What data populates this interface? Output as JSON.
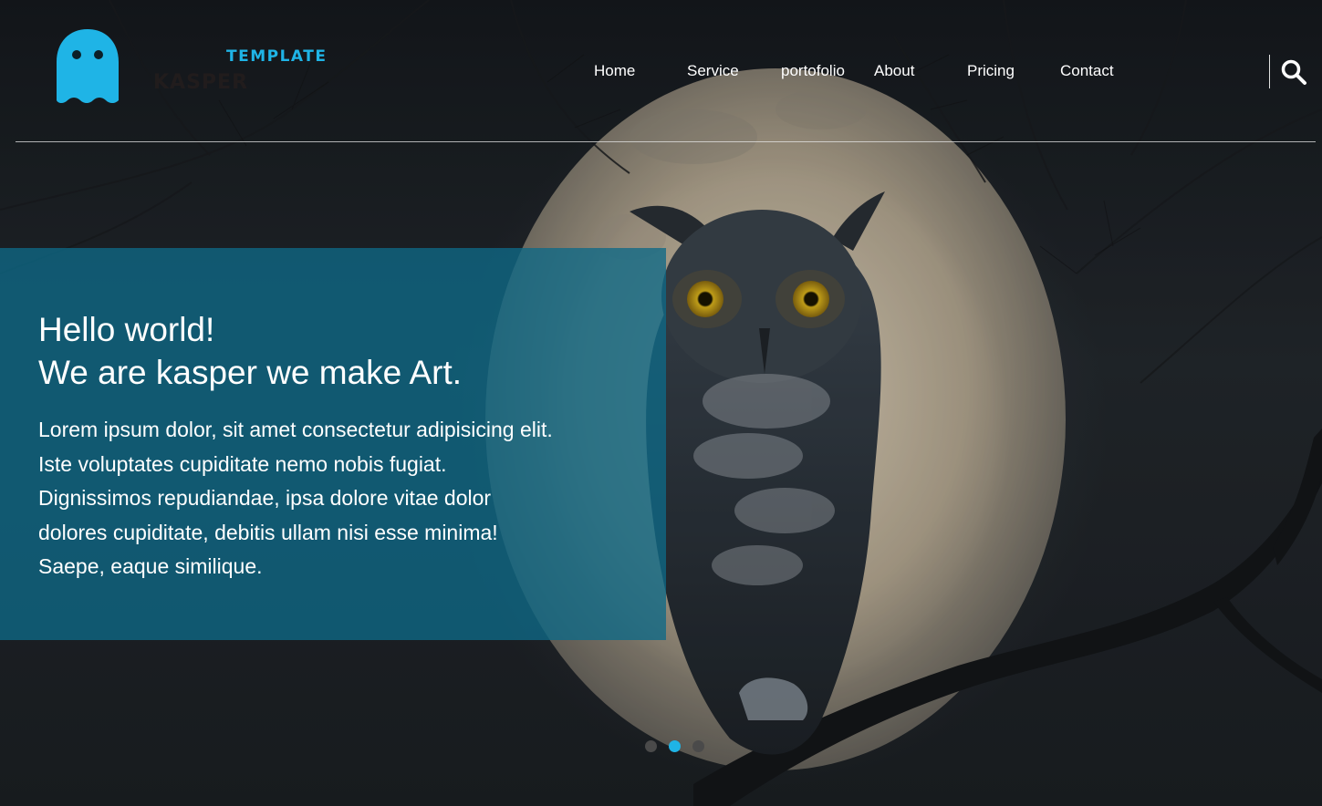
{
  "header": {
    "logo_text": "TEMPLATE",
    "logo_subtext": "KASPER",
    "nav": [
      {
        "label": "Home"
      },
      {
        "label": "Service"
      },
      {
        "label": "portofolio"
      },
      {
        "label": "About"
      },
      {
        "label": "Pricing"
      },
      {
        "label": "Contact"
      }
    ],
    "search_icon": "search-icon"
  },
  "hero": {
    "headline_line1": "Hello world!",
    "headline_line2": "We are kasper we make Art.",
    "body_lines": [
      "Lorem ipsum dolor, sit amet consectetur adipisicing elit.",
      "Iste voluptates cupiditate nemo nobis fugiat.",
      "Dignissimos repudiandae, ipsa dolore vitae dolor",
      "dolores cupiditate, debitis ullam nisi esse minima!",
      "Saepe, eaque similique."
    ],
    "slider": {
      "count": 3,
      "active": 1
    }
  },
  "colors": {
    "accent": "#1fb4e6",
    "text_box": "#0e6987",
    "dot_inactive": "#4a4a4a"
  }
}
